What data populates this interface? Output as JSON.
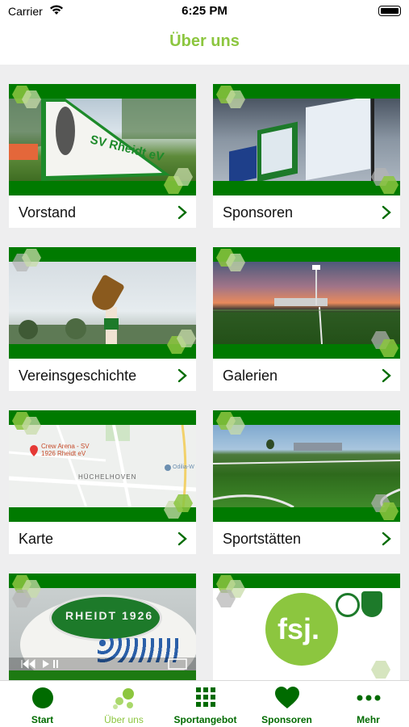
{
  "status": {
    "carrier": "Carrier",
    "time": "6:25 PM"
  },
  "nav": {
    "title": "Über uns"
  },
  "colors": {
    "accent": "#8cc63f",
    "brand": "#007a00"
  },
  "cards": [
    {
      "label": "Vorstand",
      "flag_text": "SV Rheidt eV"
    },
    {
      "label": "Sponsoren"
    },
    {
      "label": "Vereinsgeschichte"
    },
    {
      "label": "Galerien"
    },
    {
      "label": "Karte",
      "map_pin": "Crew Arena - SV\n1926 Rheidt eV",
      "map_place": "HÜCHELHOVEN",
      "map_pin2": "Odilia-W"
    },
    {
      "label": "Sportstätten"
    },
    {
      "label": "",
      "cake_text": "RHEIDT 1926"
    },
    {
      "label": "",
      "logo_text": "fsj."
    }
  ],
  "tabs": [
    {
      "label": "Start",
      "icon": "circle-icon"
    },
    {
      "label": "Über uns",
      "icon": "bubbles-icon",
      "active": true
    },
    {
      "label": "Sportangebot",
      "icon": "grid-icon"
    },
    {
      "label": "Sponsoren",
      "icon": "heart-icon"
    },
    {
      "label": "Mehr",
      "icon": "more-dots-icon"
    }
  ]
}
